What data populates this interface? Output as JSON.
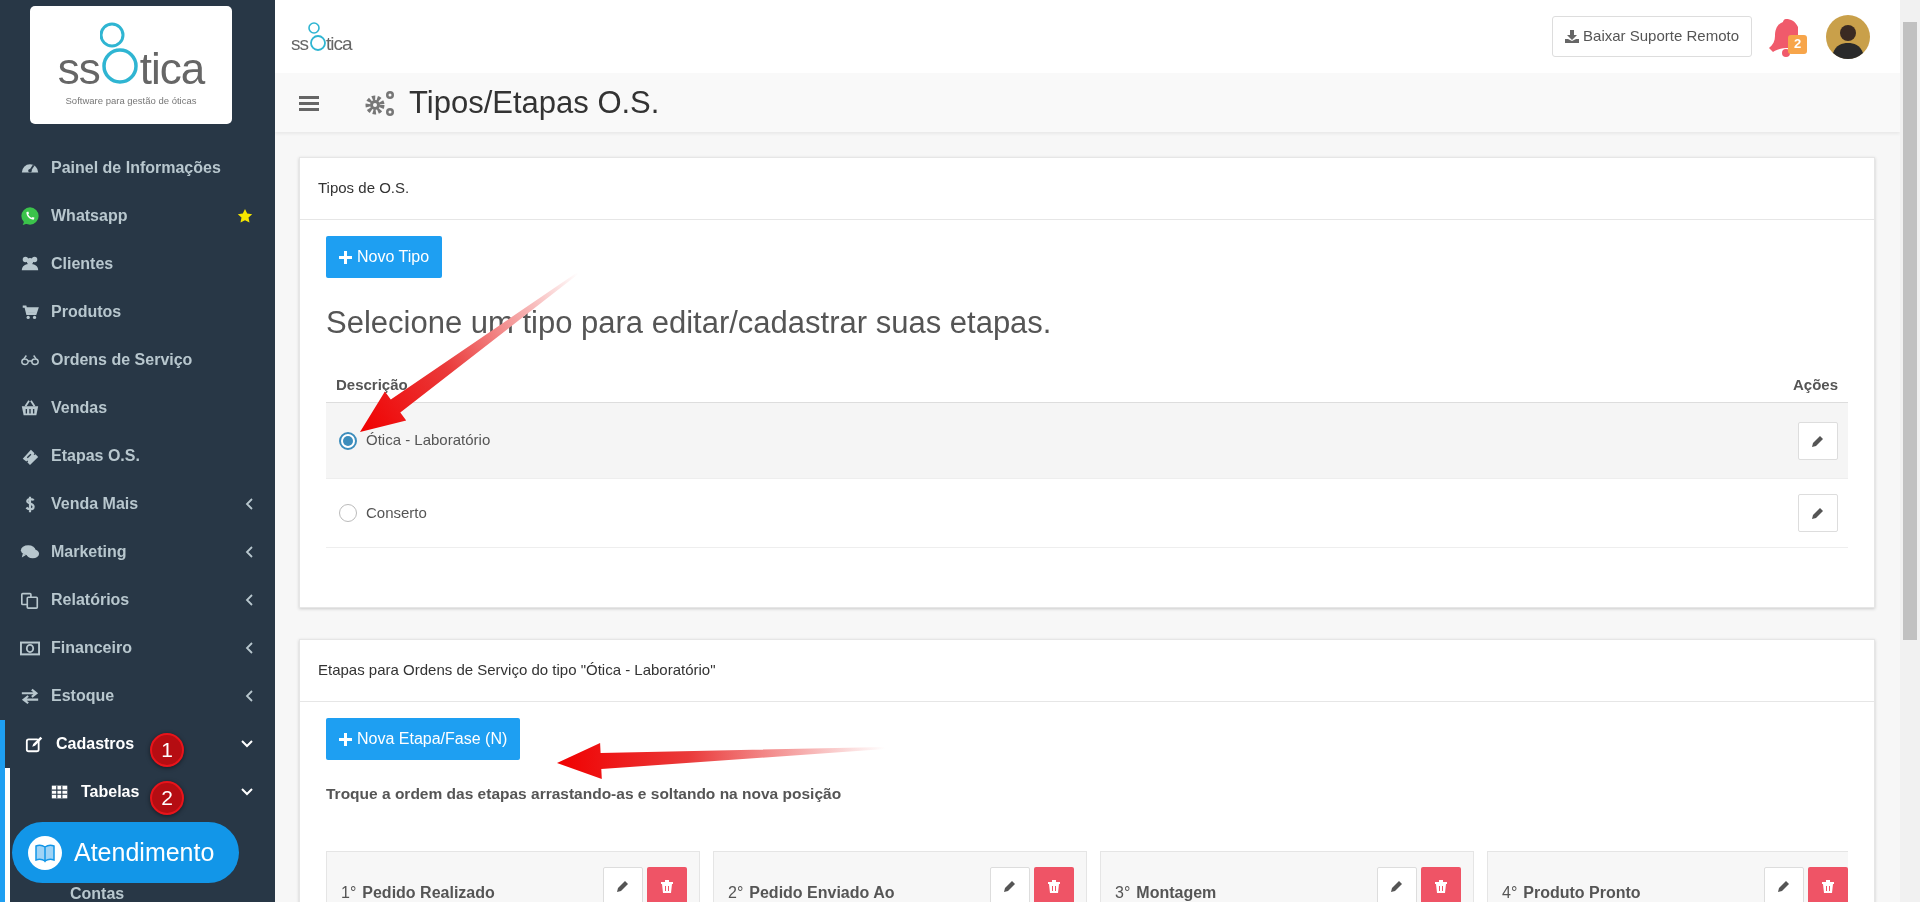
{
  "logo": {
    "left": "ss",
    "right": "tica",
    "tagline": "Software para gestão de óticas"
  },
  "sidebar": {
    "items": [
      {
        "label": "Painel de Informações",
        "selected": false
      },
      {
        "label": "Whatsapp",
        "selected": false,
        "starred": true
      },
      {
        "label": "Clientes",
        "selected": false
      },
      {
        "label": "Produtos",
        "selected": false
      },
      {
        "label": "Ordens de Serviço",
        "selected": false
      },
      {
        "label": "Vendas",
        "selected": false
      },
      {
        "label": "Etapas O.S.",
        "selected": false
      },
      {
        "label": "Venda Mais",
        "selected": false,
        "expanded": false
      },
      {
        "label": "Marketing",
        "selected": false,
        "expanded": false
      },
      {
        "label": "Relatórios",
        "selected": false,
        "expanded": false
      },
      {
        "label": "Financeiro",
        "selected": false,
        "expanded": false
      },
      {
        "label": "Estoque",
        "selected": false,
        "expanded": false
      },
      {
        "label": "Cadastros",
        "selected": true,
        "expanded": true,
        "marker": "1",
        "children": [
          {
            "label": "Tabelas",
            "selected": false,
            "expanded": true,
            "marker": "2",
            "children": [
              {
                "label": "Contas",
                "selected": false
              }
            ]
          }
        ]
      }
    ]
  },
  "chat_button": {
    "label": "Atendimento"
  },
  "header": {
    "logo": {
      "left": "ss",
      "right": "tica"
    },
    "support_button": "Baixar Suporte Remoto",
    "notifications": "2"
  },
  "page_title": "Tipos/Etapas O.S.",
  "types_card": {
    "title": "Tipos de O.S.",
    "new_button": "Novo Tipo",
    "prompt": "Selecione um tipo para editar/cadastrar suas etapas.",
    "columns": [
      "Descrição",
      "Ações"
    ],
    "rows": [
      {
        "label": "Ótica - Laboratório",
        "selected": true
      },
      {
        "label": "Conserto",
        "selected": false
      }
    ]
  },
  "stages_card": {
    "title": "Etapas para Ordens de Serviço do tipo \"Ótica - Laboratório\"",
    "new_button": "Nova Etapa/Fase (N)",
    "hint": "Troque a ordem das etapas arrastando-as e soltando na nova posição",
    "stages": [
      {
        "order": "1°",
        "name": "Pedido Realizado"
      },
      {
        "order": "2°",
        "name": "Pedido Enviado Ao"
      },
      {
        "order": "3°",
        "name": "Montagem"
      },
      {
        "order": "4°",
        "name": "Produto Pronto"
      }
    ]
  }
}
